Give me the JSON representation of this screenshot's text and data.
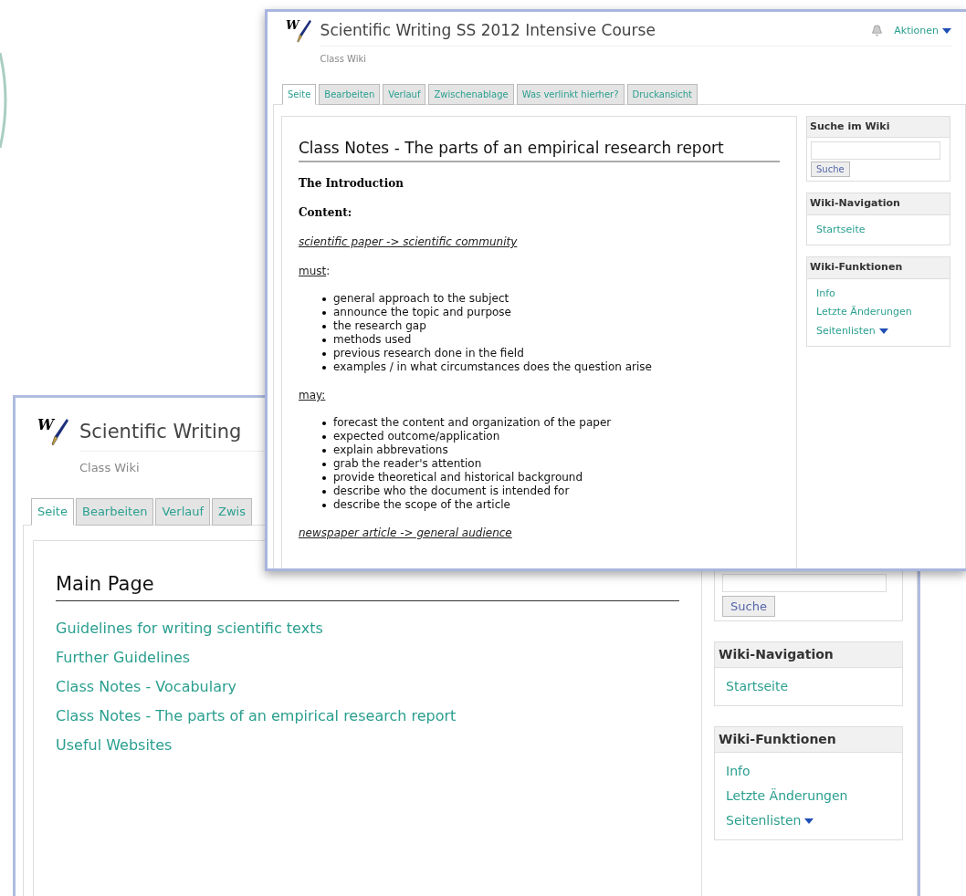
{
  "back_window": {
    "logo_letter": "W",
    "title": "Scientific Writing",
    "subtitle": "Class Wiki",
    "tabs": [
      {
        "label": "Seite",
        "selected": true
      },
      {
        "label": "Bearbeiten",
        "selected": false
      },
      {
        "label": "Verlauf",
        "selected": false
      },
      {
        "label": "Zwis",
        "selected": false
      }
    ],
    "main_heading": "Main Page",
    "links": [
      "Guidelines for writing scientific texts",
      "Further Guidelines",
      "Class Notes - Vocabulary",
      "Class Notes - The parts of an empirical research report",
      "Useful Websites"
    ],
    "sidebar": {
      "search_button": "Suche",
      "panels": [
        {
          "title": "Wiki-Navigation",
          "items": [
            {
              "label": "Startseite",
              "dropdown": false
            }
          ]
        },
        {
          "title": "Wiki-Funktionen",
          "items": [
            {
              "label": "Info",
              "dropdown": false
            },
            {
              "label": "Letzte Änderungen",
              "dropdown": false
            },
            {
              "label": "Seitenlisten",
              "dropdown": true
            }
          ]
        }
      ]
    }
  },
  "front_window": {
    "logo_letter": "W",
    "title": "Scientific Writing SS 2012 Intensive Course",
    "subtitle": "Class Wiki",
    "actions": "Aktionen",
    "tabs": [
      {
        "label": "Seite",
        "selected": true
      },
      {
        "label": "Bearbeiten",
        "selected": false
      },
      {
        "label": "Verlauf",
        "selected": false
      },
      {
        "label": "Zwischenablage",
        "selected": false
      },
      {
        "label": "Was verlinkt hierher?",
        "selected": false
      },
      {
        "label": "Druckansicht",
        "selected": false
      }
    ],
    "heading": "Class Notes - The parts of an empirical research report",
    "blocks": [
      {
        "kind": "bold",
        "text": "The Introduction"
      },
      {
        "kind": "bold",
        "text": "**Content**:"
      },
      {
        "kind": "topic",
        "text": "scientific paper -> scientific community"
      },
      {
        "kind": "label",
        "underlined": "must",
        "rest": ":"
      },
      {
        "kind": "list",
        "items": [
          "general approach to the subject",
          "announce the topic and purpose",
          "the research gap",
          "methods used",
          "previous research done in the field",
          "examples / in what circumstances does the question arise"
        ]
      },
      {
        "kind": "label",
        "underlined": "may:"
      },
      {
        "kind": "list",
        "items": [
          "forecast the content and organization of the paper",
          "expected outcome/application",
          "explain abbrevations",
          "grab the reader's attention",
          "provide theoretical and historical background",
          "describe who the document is intended for",
          "describe the scope of the article"
        ]
      },
      {
        "kind": "topic",
        "text": "newspaper article -> general audience"
      }
    ],
    "sidebar": {
      "search_title": "Suche im Wiki",
      "search_button": "Suche",
      "panels": [
        {
          "title": "Wiki-Navigation",
          "items": [
            {
              "label": "Startseite",
              "dropdown": false
            }
          ]
        },
        {
          "title": "Wiki-Funktionen",
          "items": [
            {
              "label": "Info",
              "dropdown": false
            },
            {
              "label": "Letzte Änderungen",
              "dropdown": false
            },
            {
              "label": "Seitenlisten",
              "dropdown": true
            }
          ]
        }
      ]
    }
  }
}
